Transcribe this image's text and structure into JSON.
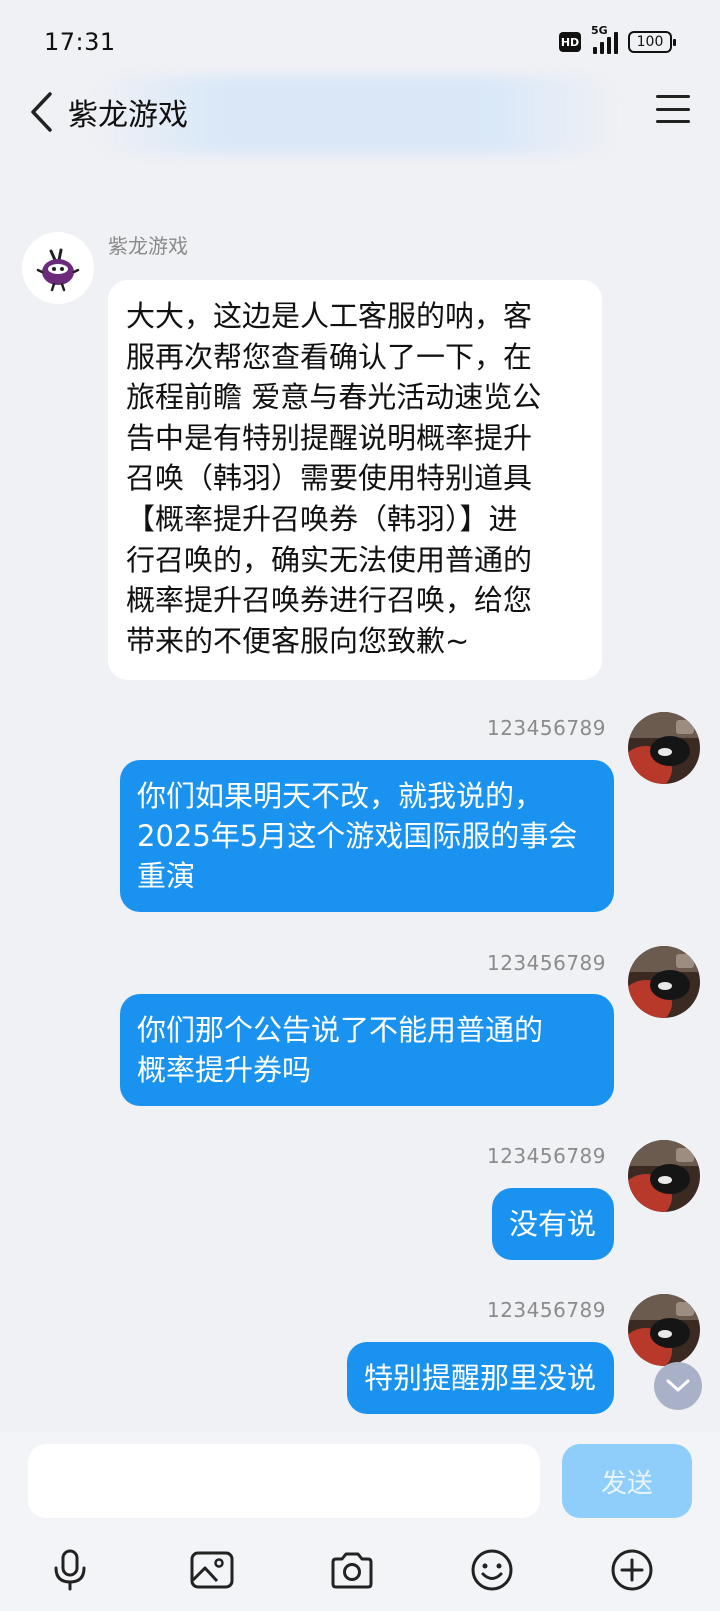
{
  "status_bar": {
    "time": "17:31",
    "hd": "HD",
    "network": "5G",
    "battery": "100"
  },
  "header": {
    "title": "紫龙游戏",
    "back_icon": "chevron-left-icon",
    "menu_icon": "hamburger-menu-icon"
  },
  "messages": [
    {
      "direction": "incoming",
      "sender": "紫龙游戏",
      "lines": [
        "大大，这边是人工客服的呐，客",
        "服再次帮您查看确认了一下，在",
        "旅程前瞻 爱意与春光活动速览公",
        "告中是有特别提醒说明概率提升",
        "召唤（韩羽）需要使用特别道具",
        "【概率提升召唤券（韩羽）】进",
        "行召唤的，确实无法使用普通的",
        "概率提升召唤券进行召唤，给您",
        "带来的不便客服向您致歉~"
      ]
    },
    {
      "direction": "outgoing",
      "sender": "123456789",
      "lines": [
        "你们如果明天不改，就我说的，",
        "2025年5月这个游戏国际服的事会",
        "重演"
      ]
    },
    {
      "direction": "outgoing",
      "sender": "123456789",
      "lines": [
        "你们那个公告说了不能用普通的",
        "概率提升券吗"
      ]
    },
    {
      "direction": "outgoing",
      "sender": "123456789",
      "lines": [
        "没有说"
      ]
    },
    {
      "direction": "outgoing",
      "sender": "123456789",
      "lines": [
        "特别提醒那里没说"
      ]
    }
  ],
  "composer": {
    "input_value": "",
    "send_label": "发送"
  },
  "toolbar": [
    {
      "icon": "microphone-icon"
    },
    {
      "icon": "image-icon"
    },
    {
      "icon": "camera-icon"
    },
    {
      "icon": "emoji-icon"
    },
    {
      "icon": "plus-circle-icon"
    }
  ],
  "colors": {
    "background": "#f0f1f5",
    "outgoing_bubble": "#1a93f0",
    "incoming_bubble": "#ffffff",
    "send_button": "#8fcdfa"
  }
}
